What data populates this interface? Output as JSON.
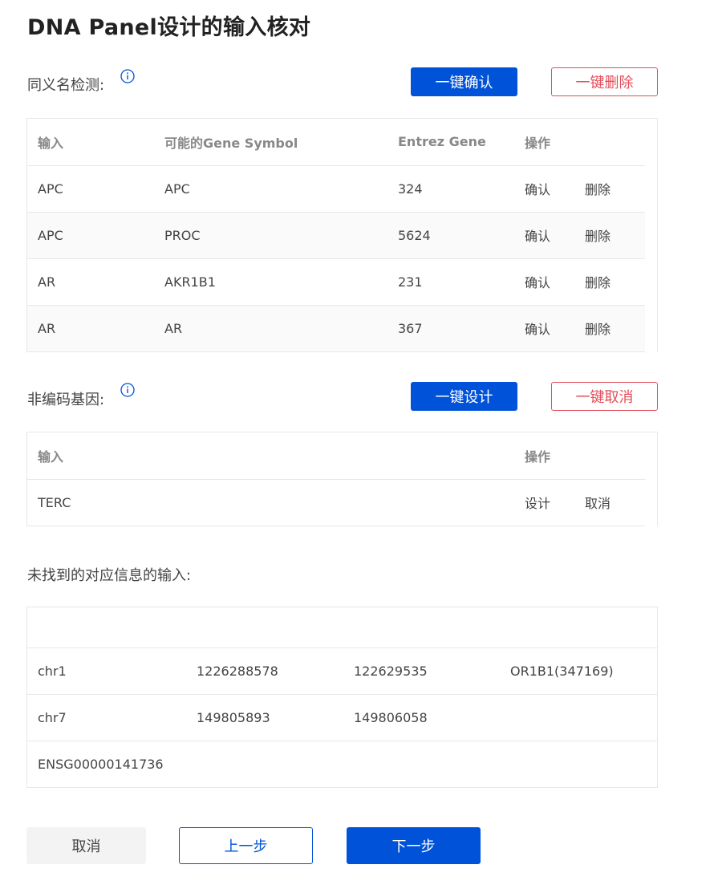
{
  "title": "DNA Panel设计的输入核对",
  "synonym": {
    "label": "同义名检测:",
    "confirm_all": "一键确认",
    "delete_all": "一键删除",
    "headers": [
      "输入",
      "可能的Gene Symbol",
      "Entrez Gene",
      "操作"
    ],
    "rows": [
      {
        "input": "APC",
        "symbol": "APC",
        "entrez": "324",
        "confirm": "确认",
        "delete": "删除"
      },
      {
        "input": "APC",
        "symbol": "PROC",
        "entrez": "5624",
        "confirm": "确认",
        "delete": "删除"
      },
      {
        "input": "AR",
        "symbol": "AKR1B1",
        "entrez": "231",
        "confirm": "确认",
        "delete": "删除"
      },
      {
        "input": "AR",
        "symbol": "AR",
        "entrez": "367",
        "confirm": "确认",
        "delete": "删除"
      }
    ]
  },
  "noncoding": {
    "label": "非编码基因:",
    "design_all": "一键设计",
    "cancel_all": "一键取消",
    "headers": [
      "输入",
      "操作"
    ],
    "rows": [
      {
        "input": "TERC",
        "design": "设计",
        "cancel": "取消"
      }
    ]
  },
  "notfound": {
    "label": "未找到的对应信息的输入:",
    "rows": [
      {
        "c1": "chr1",
        "c2": "1226288578",
        "c3": "122629535",
        "c4": "OR1B1(347169)"
      },
      {
        "c1": "chr7",
        "c2": "149805893",
        "c3": "149806058",
        "c4": ""
      },
      {
        "c1": "ENSG00000141736",
        "c2": "",
        "c3": "",
        "c4": ""
      }
    ]
  },
  "footer": {
    "cancel": "取消",
    "prev": "上一步",
    "next": "下一步"
  },
  "colors": {
    "primary": "#0052d9",
    "danger": "#e34d59",
    "border": "#e7e7e7"
  },
  "icons": {
    "info": "info-circle-icon"
  }
}
